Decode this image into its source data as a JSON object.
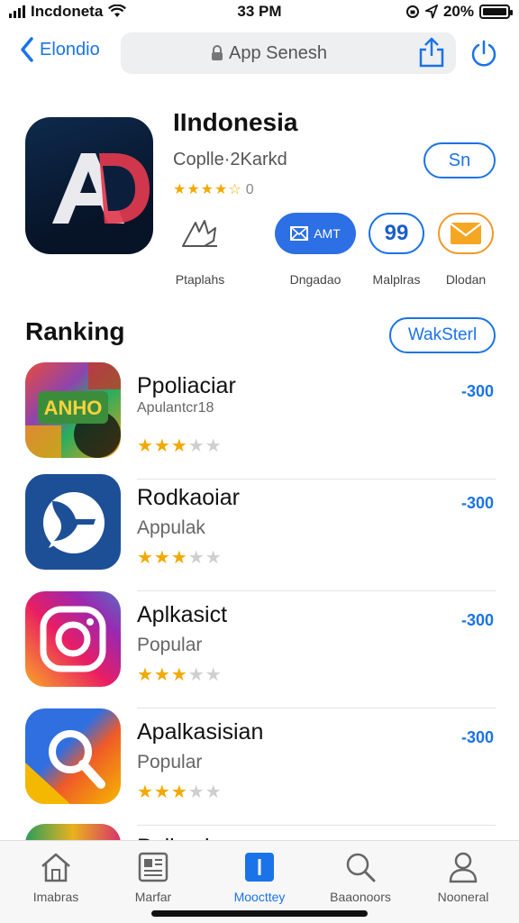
{
  "status": {
    "carrier": "Incdoneta",
    "time": "33 PM",
    "battery": "20%"
  },
  "nav": {
    "back_label": "Elondio",
    "search_placeholder": "App Senesh"
  },
  "app": {
    "title": "IIndonesia",
    "subtitle": "Coplle·2Karkd",
    "rating_count": "0",
    "get_label": "Sn",
    "icon_text": "AD",
    "actions": [
      {
        "label": "Ptaplahs",
        "button_text": ""
      },
      {
        "label": "Dngadao",
        "button_text": "AMT"
      },
      {
        "label": "Malplras",
        "button_text": "99"
      },
      {
        "label": "Dlodan",
        "button_text": ""
      }
    ]
  },
  "ranking": {
    "title": "Ranking",
    "see_all_label": "WakSterl",
    "items": [
      {
        "name": "Ppoliaciar",
        "category": "Apulantcr18",
        "rating": 3,
        "price": "-300",
        "icon": "colorful-app-icon"
      },
      {
        "name": "Rodkaoiar",
        "category": "Appulak",
        "rating": 3,
        "price": "-300",
        "icon": "blue-bird-icon"
      },
      {
        "name": "Aplkasict",
        "category": "Popular",
        "rating": 3,
        "price": "-300",
        "icon": "camera-app-icon"
      },
      {
        "name": "Apalkasisian",
        "category": "Popular",
        "rating": 3,
        "price": "-300",
        "icon": "magnifier-app-icon"
      },
      {
        "name": "Pulkaskar",
        "category": "",
        "rating": 0,
        "price": "",
        "icon": "partial-app-icon"
      }
    ]
  },
  "tabs": [
    {
      "label": "Imabras",
      "icon": "home-icon"
    },
    {
      "label": "Marfar",
      "icon": "document-icon"
    },
    {
      "label": "Moocttey",
      "icon": "active-app-icon"
    },
    {
      "label": "Baaonoors",
      "icon": "search-icon"
    },
    {
      "label": "Nooneral",
      "icon": "person-icon"
    }
  ],
  "colors": {
    "accent": "#1a73e8",
    "star": "#f2a900",
    "orange": "#f29a2e"
  }
}
